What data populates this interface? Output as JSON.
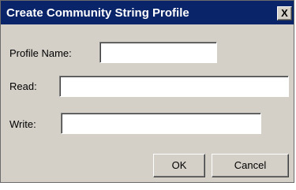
{
  "dialog": {
    "title": "Create Community String Profile",
    "close_glyph": "X"
  },
  "fields": {
    "profile_name": {
      "label": "Profile Name:",
      "value": ""
    },
    "read": {
      "label": "Read:",
      "value": ""
    },
    "write": {
      "label": "Write:",
      "value": ""
    }
  },
  "buttons": {
    "ok": "OK",
    "cancel": "Cancel"
  },
  "colors": {
    "titlebar": "#0a246a",
    "dialog_face": "#d4d0c8",
    "title_text": "#ffffff"
  },
  "icons": {
    "close": "close-icon"
  }
}
